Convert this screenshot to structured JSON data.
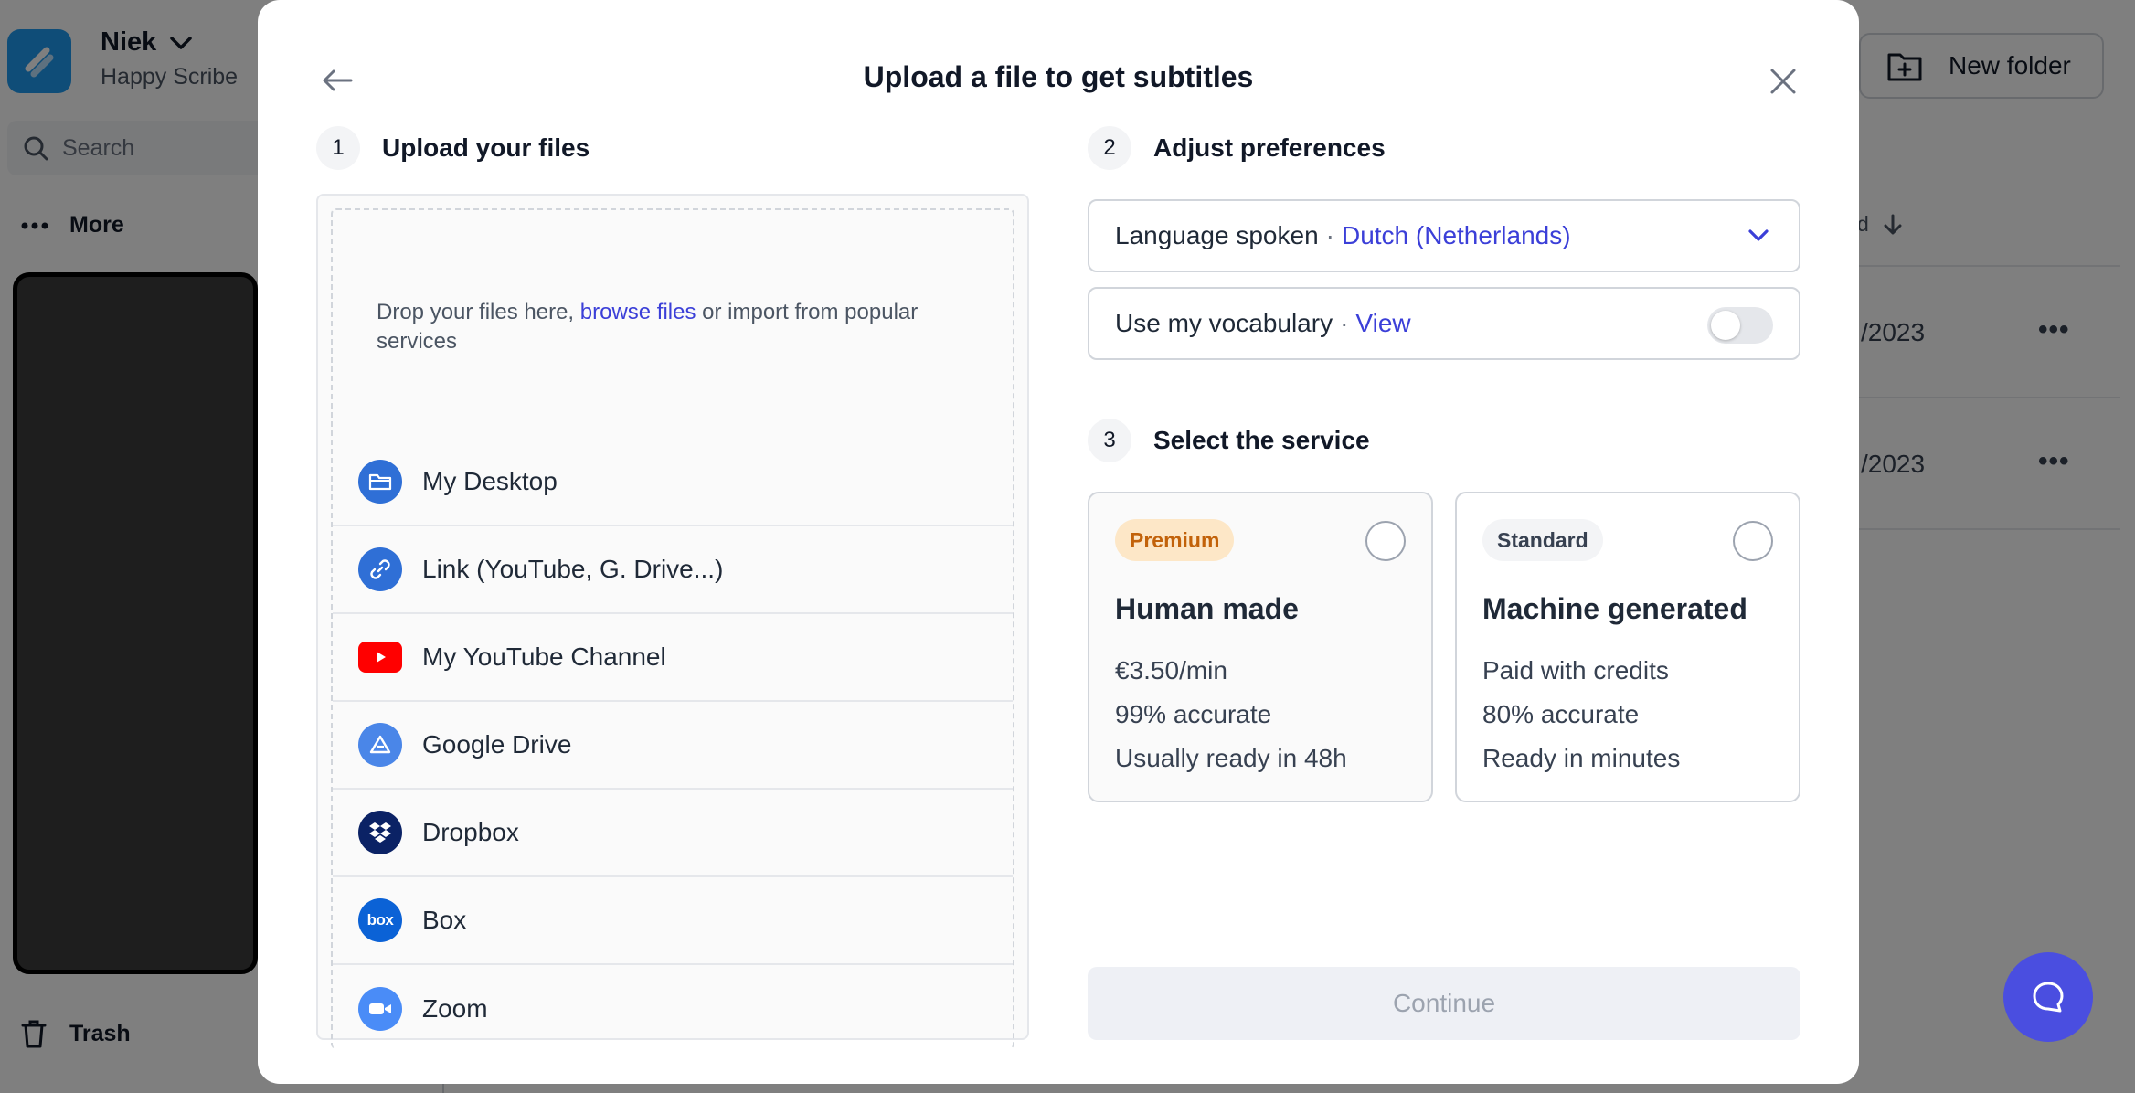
{
  "sidebar": {
    "workspace_name": "Niek",
    "workspace_sub": "Happy Scribe",
    "search_placeholder": "Search",
    "more_label": "More",
    "trash_label": "Trash"
  },
  "background": {
    "new_folder_label": "New folder",
    "column_header": "d",
    "rows": [
      {
        "date": "/2023"
      },
      {
        "date": "/2023"
      }
    ]
  },
  "modal": {
    "title": "Upload a file to get subtitles",
    "step1": {
      "num": "1",
      "label": "Upload your files"
    },
    "drop_text_before": "Drop your files here, ",
    "drop_link": "browse files",
    "drop_text_after": " or import from popular services",
    "sources": [
      {
        "label": "My Desktop",
        "icon": "folder-icon"
      },
      {
        "label": "Link (YouTube, G. Drive...)",
        "icon": "link-icon"
      },
      {
        "label": "My YouTube Channel",
        "icon": "youtube-icon"
      },
      {
        "label": "Google Drive",
        "icon": "google-drive-icon"
      },
      {
        "label": "Dropbox",
        "icon": "dropbox-icon"
      },
      {
        "label": "Box",
        "icon": "box-icon"
      },
      {
        "label": "Zoom",
        "icon": "zoom-icon"
      }
    ],
    "step2": {
      "num": "2",
      "label": "Adjust preferences"
    },
    "language": {
      "label": "Language spoken",
      "sep": "·",
      "value": "Dutch (Netherlands)"
    },
    "vocabulary": {
      "label": "Use my vocabulary",
      "sep": "·",
      "link": "View",
      "enabled": false
    },
    "step3": {
      "num": "3",
      "label": "Select the service"
    },
    "services": [
      {
        "badge": "Premium",
        "title": "Human made",
        "lines": [
          "€3.50/min",
          "99% accurate",
          "Usually ready in 48h"
        ]
      },
      {
        "badge": "Standard",
        "title": "Machine generated",
        "lines": [
          "Paid with credits",
          "80% accurate",
          "Ready in minutes"
        ]
      }
    ],
    "continue_label": "Continue"
  },
  "colors": {
    "accent": "#3b3fd8",
    "logo": "#1e9af0",
    "chat": "#4a4ee0",
    "premium_badge_bg": "#fde7c7",
    "premium_badge_text": "#c2620a"
  }
}
